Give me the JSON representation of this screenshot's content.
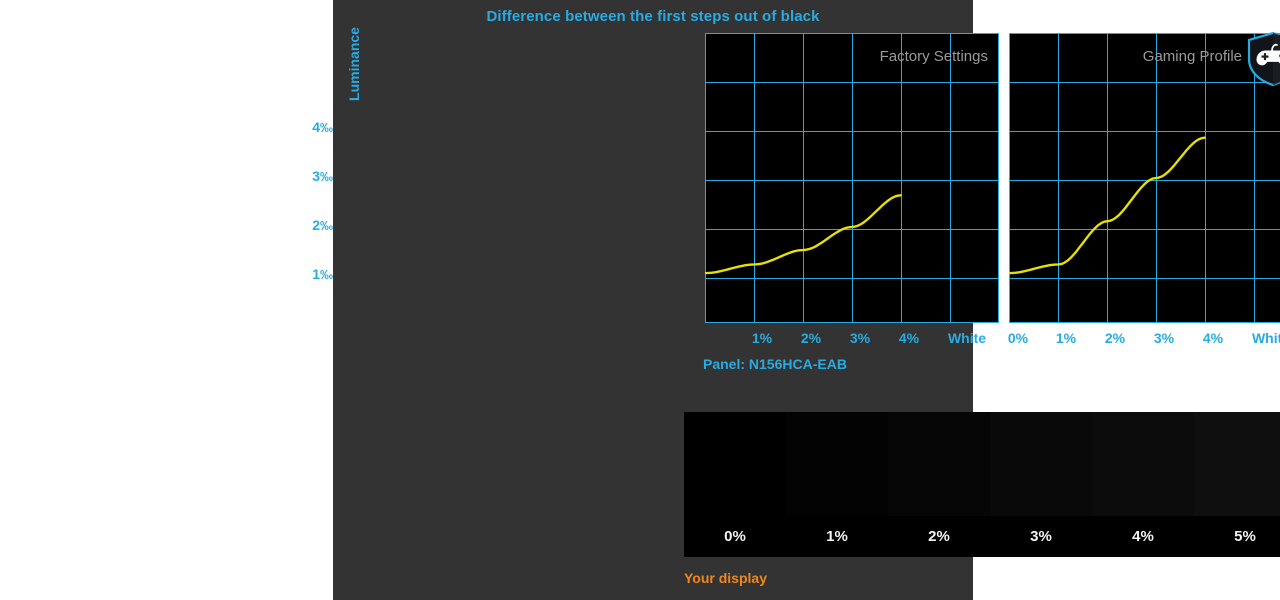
{
  "chart_data": {
    "type": "line",
    "title": "Difference between the first steps out of black",
    "ylabel": "Luminance",
    "yunit": "‰",
    "ylim": [
      0,
      5
    ],
    "yticks": [
      "1",
      "2",
      "3",
      "4"
    ],
    "ytick_values": [
      1,
      2,
      3,
      4
    ],
    "grid": true,
    "panels": [
      {
        "caption": "Factory Settings",
        "xlabel": "",
        "xticks": [
          "1%",
          "2%",
          "3%",
          "4%",
          "White"
        ],
        "x": [
          0,
          1,
          2,
          3,
          4
        ],
        "values": [
          0.85,
          1.0,
          1.25,
          1.65,
          2.2
        ],
        "line_color": "#E8E000"
      },
      {
        "caption": "Gaming Profile",
        "xlabel": "",
        "xticks": [
          "0%",
          "1%",
          "2%",
          "3%",
          "4%",
          "White"
        ],
        "x": [
          0,
          1,
          2,
          3,
          4
        ],
        "values": [
          0.85,
          1.0,
          1.75,
          2.5,
          3.2
        ],
        "line_color": "#E8E000",
        "badge_icon": "gamepad-shield-icon"
      }
    ]
  },
  "panel_info": {
    "label": "Panel: N156HCA-EAB"
  },
  "gradient_strip": {
    "steps": [
      "0%",
      "1%",
      "2%",
      "3%",
      "4%",
      "5%"
    ],
    "colors": [
      "#000000",
      "#030303",
      "#060606",
      "#090909",
      "#0c0c0c",
      "#0f0f0f"
    ],
    "footer": "Your display"
  },
  "colors": {
    "accent": "#29ABE2",
    "curve": "#E8E000",
    "orange": "#F0871E",
    "caption": "#9a9a9a",
    "panel_bg": "#333333",
    "plot_bg": "#000000"
  }
}
